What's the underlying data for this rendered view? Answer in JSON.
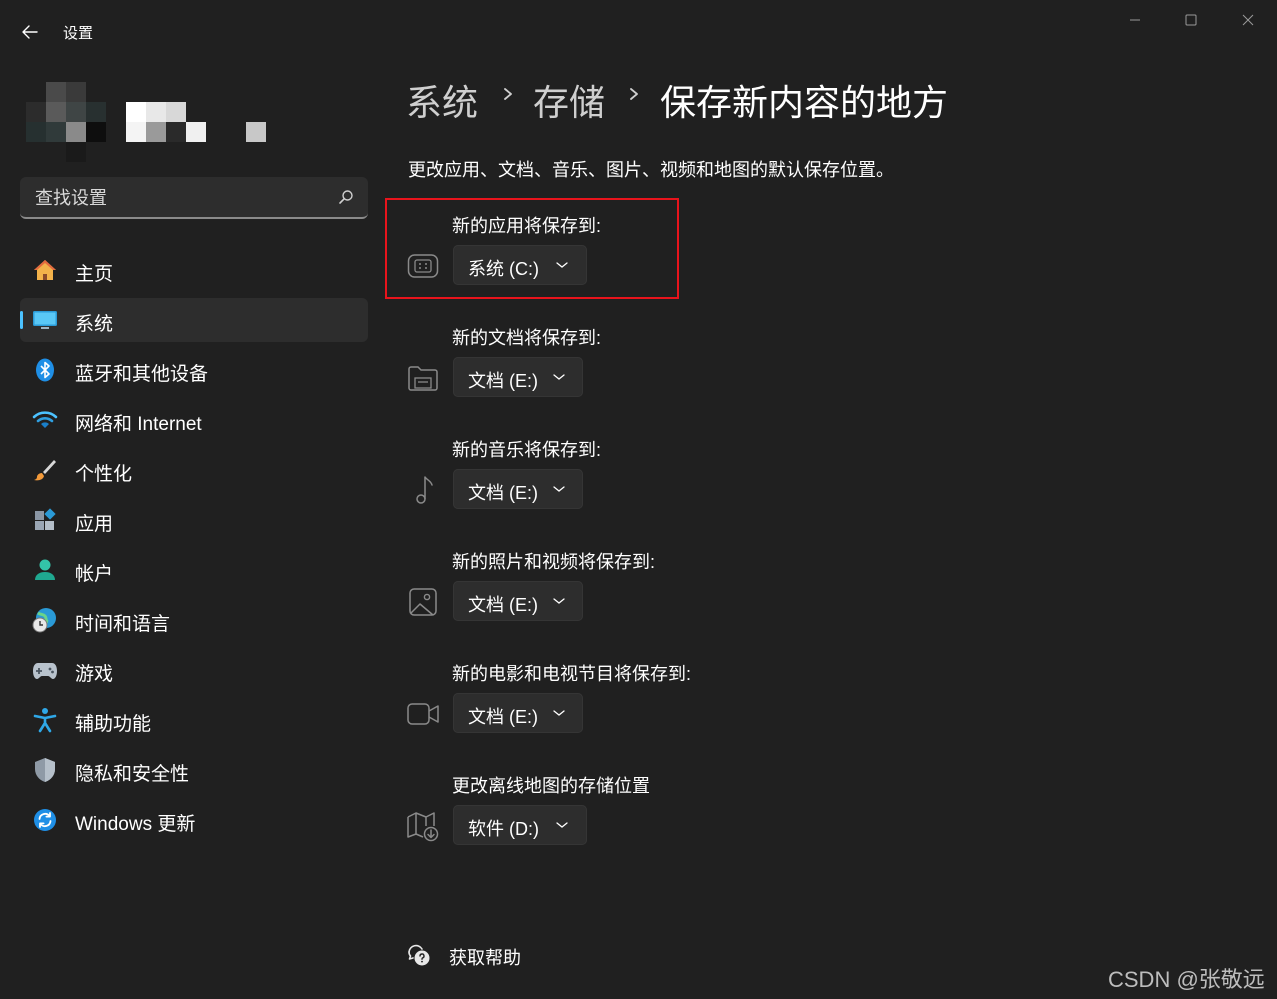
{
  "window": {
    "title": "设置"
  },
  "search": {
    "placeholder": "查找设置"
  },
  "nav": {
    "items": [
      {
        "label": "主页",
        "icon": "home-icon"
      },
      {
        "label": "系统",
        "icon": "system-display-icon",
        "selected": true
      },
      {
        "label": "蓝牙和其他设备",
        "icon": "bluetooth-icon"
      },
      {
        "label": "网络和 Internet",
        "icon": "wifi-icon"
      },
      {
        "label": "个性化",
        "icon": "paintbrush-icon"
      },
      {
        "label": "应用",
        "icon": "apps-icon"
      },
      {
        "label": "帐户",
        "icon": "person-icon"
      },
      {
        "label": "时间和语言",
        "icon": "globe-clock-icon"
      },
      {
        "label": "游戏",
        "icon": "gamepad-icon"
      },
      {
        "label": "辅助功能",
        "icon": "accessibility-icon"
      },
      {
        "label": "隐私和安全性",
        "icon": "shield-icon"
      },
      {
        "label": "Windows 更新",
        "icon": "update-icon"
      }
    ]
  },
  "breadcrumb": {
    "level1": "系统",
    "level2": "存储",
    "current": "保存新内容的地方"
  },
  "description": "更改应用、文档、音乐、图片、视频和地图的默认保存位置。",
  "rows": [
    {
      "label": "新的应用将保存到:",
      "value": "系统 (C:)",
      "icon": "app-grid-icon"
    },
    {
      "label": "新的文档将保存到:",
      "value": "文档 (E:)",
      "icon": "folder-icon"
    },
    {
      "label": "新的音乐将保存到:",
      "value": "文档 (E:)",
      "icon": "music-note-icon"
    },
    {
      "label": "新的照片和视频将保存到:",
      "value": "文档 (E:)",
      "icon": "picture-icon"
    },
    {
      "label": "新的电影和电视节目将保存到:",
      "value": "文档 (E:)",
      "icon": "video-camera-icon"
    },
    {
      "label": "更改离线地图的存储位置",
      "value": "软件 (D:)",
      "icon": "map-download-icon"
    }
  ],
  "help": {
    "label": "获取帮助"
  },
  "watermark": "CSDN @张敬远",
  "colors": {
    "background": "#202020",
    "accent": "#4cc2ff",
    "highlight": "#e8141c"
  }
}
